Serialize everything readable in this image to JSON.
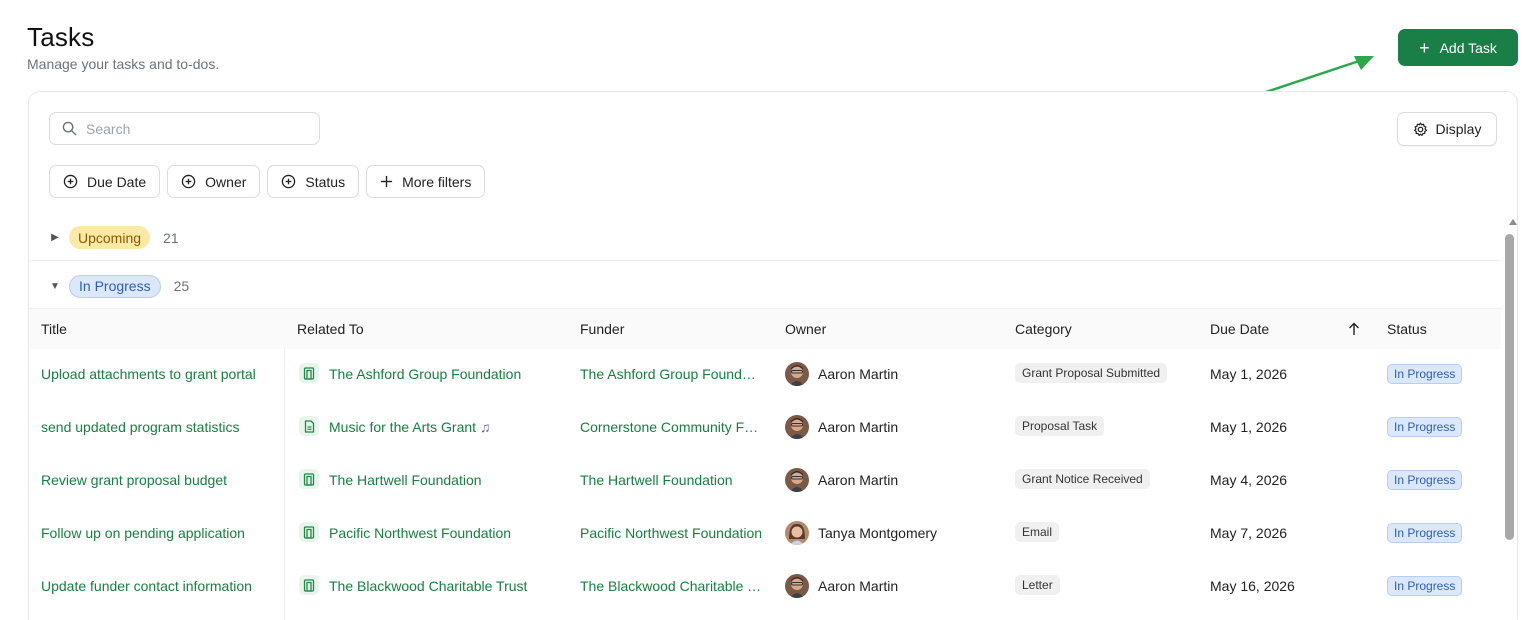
{
  "header": {
    "title": "Tasks",
    "subtitle": "Manage your tasks and to-dos.",
    "add_task_label": "Add Task",
    "accent_color": "#1a7f46"
  },
  "toolbar": {
    "search_placeholder": "Search",
    "display_label": "Display",
    "filters": [
      "Due Date",
      "Owner",
      "Status",
      "More filters"
    ]
  },
  "groups": {
    "upcoming": {
      "label": "Upcoming",
      "count": "21",
      "expanded": false
    },
    "in_progress": {
      "label": "In Progress",
      "count": "25",
      "expanded": true
    }
  },
  "table": {
    "columns": {
      "title": "Title",
      "related_to": "Related To",
      "funder": "Funder",
      "owner": "Owner",
      "category": "Category",
      "due_date": "Due Date",
      "status": "Status"
    },
    "sort": {
      "column": "Due Date",
      "direction": "ascending"
    },
    "rows": [
      {
        "title": "Upload attachments to grant portal",
        "related_to": "The Ashford Group Foundation",
        "related_icon": "building-icon",
        "funder": "The Ashford Group Foundation",
        "owner": "Aaron Martin",
        "owner_avatar": "male",
        "category": "Grant Proposal Submitted",
        "due_date": "May 1, 2026",
        "status": "In Progress"
      },
      {
        "title": "send updated program statistics",
        "related_to": "Music for the Arts Grant",
        "related_icon": "document-icon",
        "related_suffix": "♫",
        "funder": "Cornerstone Community Foundation",
        "owner": "Aaron Martin",
        "owner_avatar": "male",
        "category": "Proposal Task",
        "due_date": "May 1, 2026",
        "status": "In Progress"
      },
      {
        "title": "Review grant proposal budget",
        "related_to": "The Hartwell Foundation",
        "related_icon": "building-icon",
        "funder": "The Hartwell Foundation",
        "owner": "Aaron Martin",
        "owner_avatar": "male",
        "category": "Grant Notice Received",
        "due_date": "May 4, 2026",
        "status": "In Progress"
      },
      {
        "title": "Follow up on pending application",
        "related_to": "Pacific Northwest Foundation",
        "related_icon": "building-icon",
        "funder": "Pacific Northwest Foundation",
        "owner": "Tanya Montgomery",
        "owner_avatar": "female",
        "category": "Email",
        "due_date": "May 7, 2026",
        "status": "In Progress"
      },
      {
        "title": "Update funder contact information",
        "related_to": "The Blackwood Charitable Trust",
        "related_icon": "building-icon",
        "funder": "The Blackwood Charitable Trust",
        "owner": "Aaron Martin",
        "owner_avatar": "male",
        "category": "Letter",
        "due_date": "May 16, 2026",
        "status": "In Progress"
      }
    ]
  }
}
